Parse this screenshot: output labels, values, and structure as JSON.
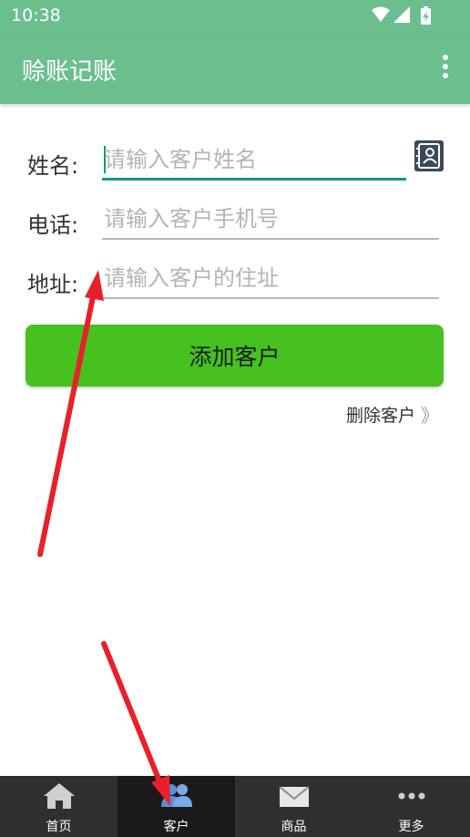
{
  "status_bar": {
    "time": "10:38"
  },
  "app_bar": {
    "title": "赊账记账"
  },
  "form": {
    "name": {
      "label": "姓名:",
      "placeholder": "请输入客户姓名",
      "value": ""
    },
    "phone": {
      "label": "电话:",
      "placeholder": "请输入客户手机号",
      "value": ""
    },
    "address": {
      "label": "地址:",
      "placeholder": "请输入客户的住址",
      "value": ""
    }
  },
  "actions": {
    "add_label": "添加客户",
    "delete_label": "删除客户",
    "delete_chevron": "》"
  },
  "bottom_nav": {
    "tabs": [
      {
        "label": "首页",
        "icon": "home-icon",
        "active": false
      },
      {
        "label": "客户",
        "icon": "customers-icon",
        "active": true
      },
      {
        "label": "商品",
        "icon": "mail-icon",
        "active": false
      },
      {
        "label": "更多",
        "icon": "more-icon",
        "active": false
      }
    ]
  },
  "colors": {
    "primary": "#6bbf8f",
    "accent": "#149686",
    "button": "#46c11f",
    "annotation": "#e8202a"
  }
}
